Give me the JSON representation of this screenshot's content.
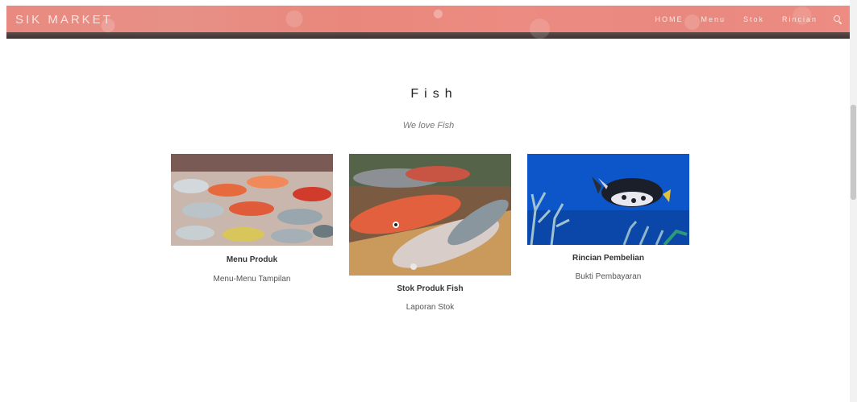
{
  "header": {
    "brand": "SIK MARKET",
    "nav": [
      "HOME",
      "Menu",
      "Stok",
      "Rincian"
    ],
    "search_icon": "search-icon",
    "accent_color": "#e98a80"
  },
  "section": {
    "title": "Fish",
    "subtitle": "We love Fish"
  },
  "cards": [
    {
      "title": "Menu Produk",
      "description": "Menu-Menu Tampilan"
    },
    {
      "title": "Stok Produk Fish",
      "description": "Laporan Stok"
    },
    {
      "title": "Rincian Pembelian",
      "description": "Bukti Pembayaran"
    }
  ]
}
